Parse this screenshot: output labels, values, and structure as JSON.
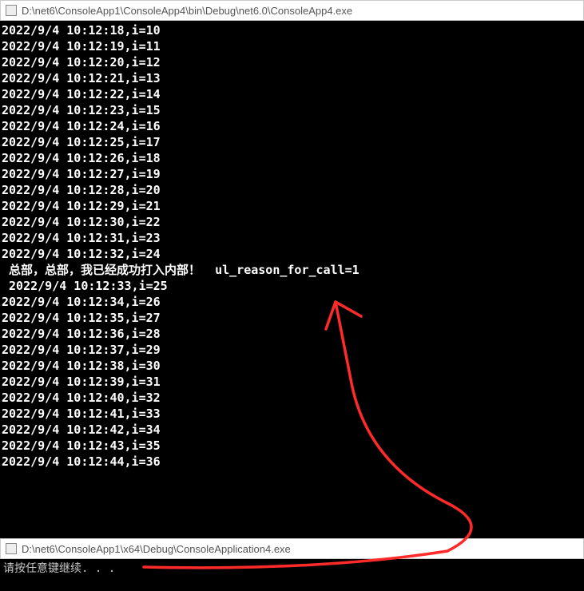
{
  "window1": {
    "title": "D:\\net6\\ConsoleApp1\\ConsoleApp4\\bin\\Debug\\net6.0\\ConsoleApp4.exe",
    "lines_before": [
      "2022/9/4 10:12:18,i=10",
      "2022/9/4 10:12:19,i=11",
      "2022/9/4 10:12:20,i=12",
      "2022/9/4 10:12:21,i=13",
      "2022/9/4 10:12:22,i=14",
      "2022/9/4 10:12:23,i=15",
      "2022/9/4 10:12:24,i=16",
      "2022/9/4 10:12:25,i=17",
      "2022/9/4 10:12:26,i=18",
      "2022/9/4 10:12:27,i=19",
      "2022/9/4 10:12:28,i=20",
      "2022/9/4 10:12:29,i=21",
      "2022/9/4 10:12:30,i=22",
      "2022/9/4 10:12:31,i=23",
      "2022/9/4 10:12:32,i=24"
    ],
    "message_line": " 总部，总部，我已经成功打入内部！  ul_reason_for_call=1",
    "message_line2": " 2022/9/4 10:12:33,i=25",
    "lines_after": [
      "2022/9/4 10:12:34,i=26",
      "2022/9/4 10:12:35,i=27",
      "2022/9/4 10:12:36,i=28",
      "2022/9/4 10:12:37,i=29",
      "2022/9/4 10:12:38,i=30",
      "2022/9/4 10:12:39,i=31",
      "2022/9/4 10:12:40,i=32",
      "2022/9/4 10:12:41,i=33",
      "2022/9/4 10:12:42,i=34",
      "2022/9/4 10:12:43,i=35",
      "2022/9/4 10:12:44,i=36"
    ]
  },
  "window2": {
    "title": "D:\\net6\\ConsoleApp1\\x64\\Debug\\ConsoleApplication4.exe",
    "prompt": "请按任意键继续. . ."
  },
  "annotation": {
    "color": "#ff2a2a"
  }
}
